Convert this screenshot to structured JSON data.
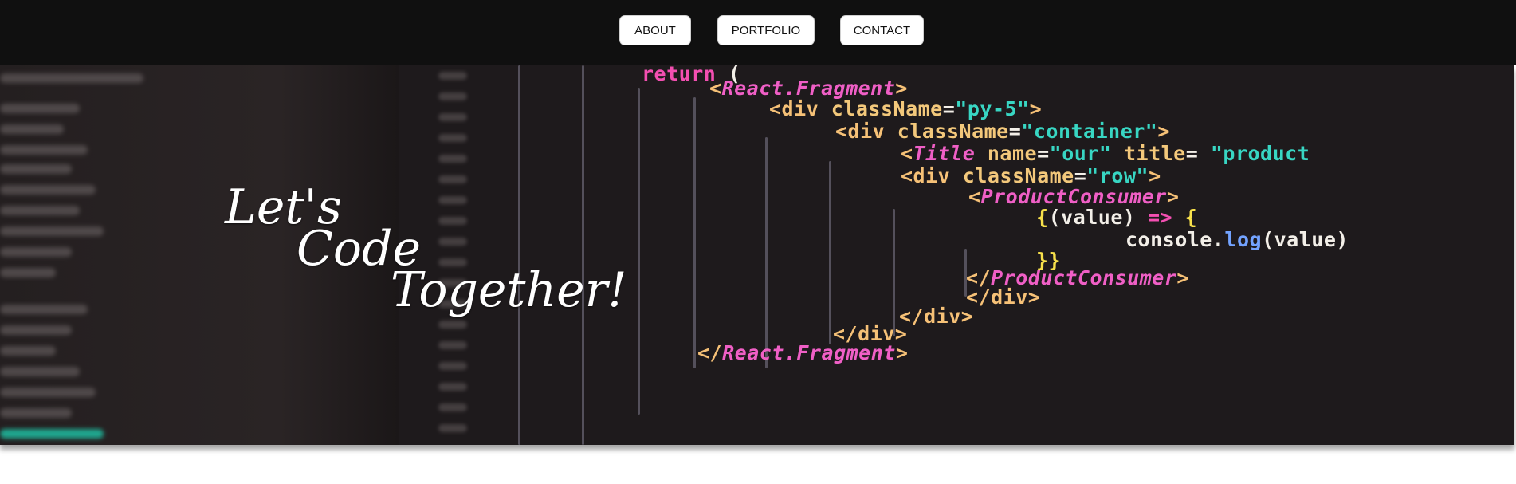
{
  "nav": {
    "about": "ABOUT",
    "portfolio": "PORTFOLIO",
    "contact": "CONTACT"
  },
  "hero": {
    "tagline_line1": "Let's",
    "tagline_line2": "Code",
    "tagline_line3": "Together!"
  },
  "code_lines": [
    {
      "parts": [
        [
          "kw",
          "return "
        ],
        [
          "wht",
          "("
        ]
      ]
    },
    {
      "parts": [
        [
          "tag",
          "<"
        ],
        [
          "comp",
          "React.Fragment"
        ],
        [
          "tag",
          ">"
        ]
      ]
    },
    {
      "parts": [
        [
          "tag",
          "<div "
        ],
        [
          "attr",
          "className"
        ],
        [
          "wht",
          "="
        ],
        [
          "str",
          "\"py-5\""
        ],
        [
          "tag",
          ">"
        ]
      ]
    },
    {
      "parts": [
        [
          "tag",
          "<div "
        ],
        [
          "attr",
          "className"
        ],
        [
          "wht",
          "="
        ],
        [
          "str",
          "\"container\""
        ],
        [
          "tag",
          ">"
        ]
      ]
    },
    {
      "parts": [
        [
          "tag",
          "<"
        ],
        [
          "comp",
          "Title "
        ],
        [
          "attr",
          "name"
        ],
        [
          "wht",
          "="
        ],
        [
          "str",
          "\"our\" "
        ],
        [
          "attr",
          "title"
        ],
        [
          "wht",
          "= "
        ],
        [
          "str",
          "\"product"
        ]
      ]
    },
    {
      "parts": [
        [
          "tag",
          "<div "
        ],
        [
          "attr",
          "className"
        ],
        [
          "wht",
          "="
        ],
        [
          "str",
          "\"row\""
        ],
        [
          "tag",
          ">"
        ]
      ]
    },
    {
      "parts": [
        [
          "tag",
          "<"
        ],
        [
          "comp",
          "ProductConsumer"
        ],
        [
          "tag",
          ">"
        ]
      ]
    },
    {
      "parts": [
        [
          "brace",
          "{"
        ],
        [
          "wht",
          "(value) "
        ],
        [
          "kw",
          "=> "
        ],
        [
          "brace",
          "{"
        ]
      ]
    },
    {
      "parts": [
        [
          "wht",
          "console."
        ],
        [
          "fn",
          "log"
        ],
        [
          "wht",
          "(value)"
        ]
      ]
    },
    {
      "parts": [
        [
          "brace",
          "}}"
        ]
      ]
    },
    {
      "parts": [
        [
          "tag",
          "</"
        ],
        [
          "comp",
          "ProductConsumer"
        ],
        [
          "tag",
          ">"
        ]
      ]
    },
    {
      "parts": [
        [
          "tag",
          "</div>"
        ]
      ]
    },
    {
      "parts": [
        [
          "tag",
          "</div>"
        ]
      ]
    },
    {
      "parts": [
        [
          "tag",
          "</div>"
        ]
      ]
    },
    {
      "parts": [
        [
          "tag",
          "</"
        ],
        [
          "comp",
          "React.Fragment"
        ],
        [
          "tag",
          ">"
        ]
      ]
    }
  ],
  "colors": {
    "topbar": "#101010",
    "hero_bg": "#1e1a1c",
    "tag": "#f6c177",
    "component": "#f05fc6",
    "string": "#38d6c3"
  }
}
